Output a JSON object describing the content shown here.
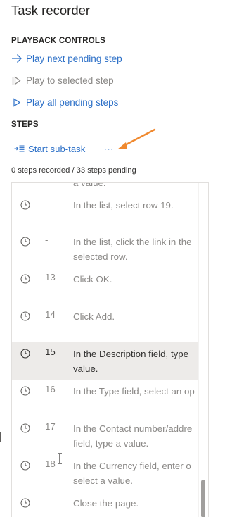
{
  "panel": {
    "title": "Task recorder"
  },
  "playback": {
    "heading": "PLAYBACK CONTROLS",
    "play_next": "Play next pending step",
    "play_selected": "Play to selected step",
    "play_all": "Play all pending steps"
  },
  "steps": {
    "heading": "STEPS",
    "start_subtask": "Start sub-task",
    "more": "⋯",
    "summary": "0 steps recorded / 33 steps pending"
  },
  "rows": [
    {
      "num": "",
      "line1": "a value.",
      "line2": ""
    },
    {
      "num": "-",
      "line1": "In the list, select row 19.",
      "line2": ""
    },
    {
      "num": "-",
      "line1": "In the list, click the link in the",
      "line2": "selected row."
    },
    {
      "num": "13",
      "line1": "Click OK.",
      "line2": ""
    },
    {
      "num": "14",
      "line1": "Click Add.",
      "line2": ""
    },
    {
      "num": "15",
      "line1": "In the Description field, type",
      "line2": "value."
    },
    {
      "num": "16",
      "line1": "In the Type field, select an op",
      "line2": ""
    },
    {
      "num": "17",
      "line1": "In the Contact number/addre",
      "line2": "field, type a value."
    },
    {
      "num": "18",
      "line1": "In the Currency field, enter o",
      "line2": "select a value."
    },
    {
      "num": "-",
      "line1": "Close the page.",
      "line2": ""
    }
  ],
  "colors": {
    "accent": "#2b6fc7",
    "selected_row": "#edebe9",
    "annotation_arrow": "#f0892f"
  }
}
